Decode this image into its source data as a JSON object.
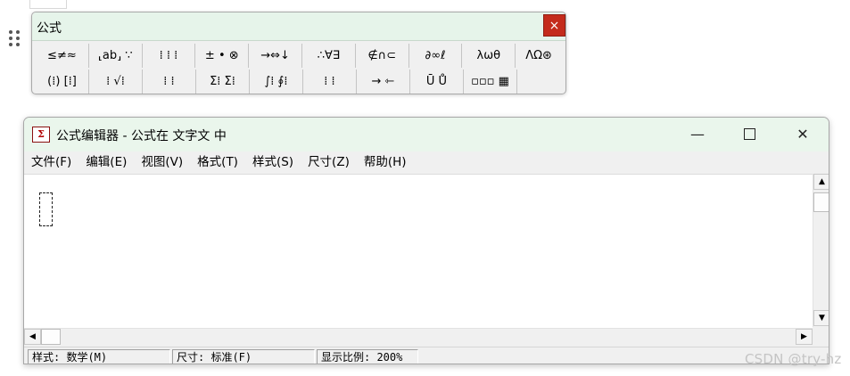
{
  "palette": {
    "title": "公式",
    "close": "×",
    "row1": [
      "≤≠≈",
      "⸤ab⸥ ∵",
      "⁞ ⁞ ⁞",
      "± • ⊗",
      "→⇔↓",
      "∴∀∃",
      "∉∩⊂",
      "∂∞ℓ",
      "λωθ",
      "ΛΩ⊛"
    ],
    "row2": [
      "(⁞) [⁞]",
      "⁞ √⁞",
      "⁞ ⁞",
      "Σ⁞ Σ⁞",
      "∫⁞ ∮⁞",
      "⁞ ⁞",
      "→ ⇽",
      "Ū Ů",
      "▫▫▫ ▦"
    ]
  },
  "window": {
    "icon": "Σ",
    "title": "公式编辑器 - 公式在 文字文 中",
    "minimize": "—",
    "close": "✕",
    "menu": [
      "文件(F)",
      "编辑(E)",
      "视图(V)",
      "格式(T)",
      "样式(S)",
      "尺寸(Z)",
      "帮助(H)"
    ]
  },
  "scroll": {
    "up": "▲",
    "down": "▼",
    "left": "◀",
    "right": "▶"
  },
  "status": {
    "style": "样式: 数学(M)",
    "size": "尺寸: 标准(F)",
    "zoom": "显示比例: 200%"
  },
  "watermark": "CSDN @try-hz"
}
